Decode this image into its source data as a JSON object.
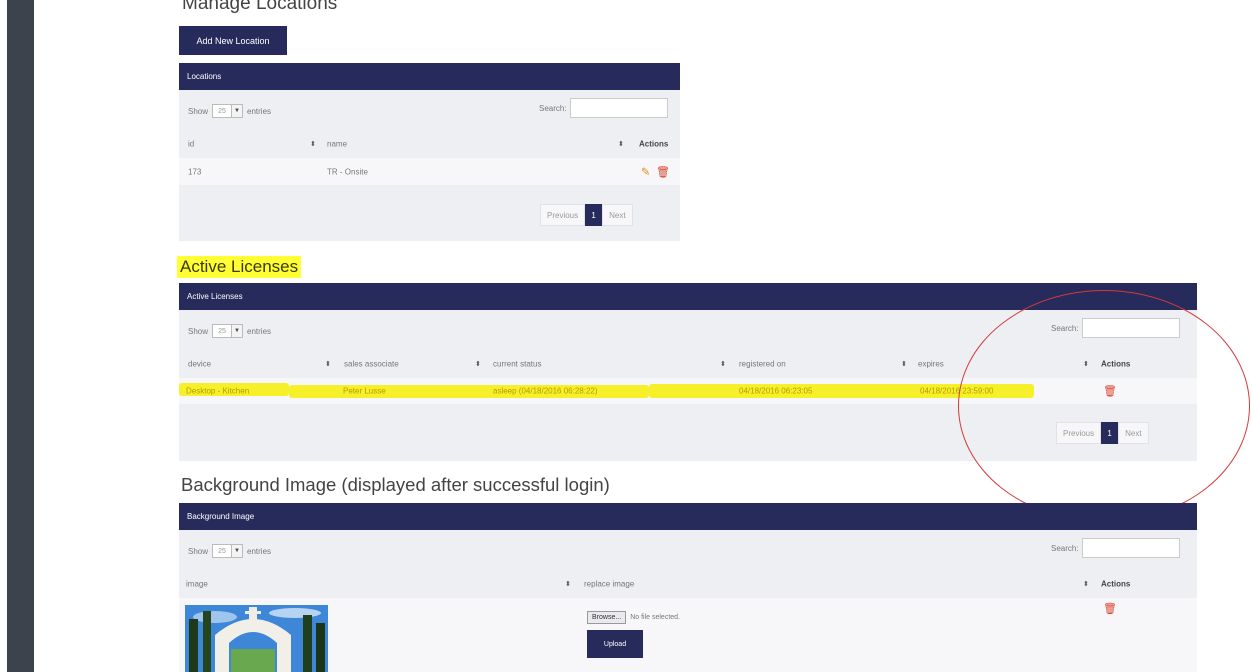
{
  "manage_locations": {
    "heading": "Manage Locations",
    "add_button": "Add New Location",
    "panel_title": "Locations",
    "show_label": "Show",
    "entries_value": "25",
    "entries_label": "entries",
    "search_label": "Search:",
    "columns": [
      "id",
      "name",
      "Actions"
    ],
    "rows": [
      {
        "id": "173",
        "name": "TR - Onsite"
      }
    ],
    "pager": {
      "prev": "Previous",
      "page": "1",
      "next": "Next"
    }
  },
  "active_licenses": {
    "heading": "Active Licenses",
    "panel_title": "Active Licenses",
    "show_label": "Show",
    "entries_value": "25",
    "entries_label": "entries",
    "search_label": "Search:",
    "columns": [
      "device",
      "sales associate",
      "current status",
      "registered on",
      "expires",
      "Actions"
    ],
    "rows": [
      {
        "device": "Desktop - Kitchen",
        "sales_associate": "Peter Lusse",
        "current_status": "asleep (04/18/2016 06:28:22)",
        "registered_on": "04/18/2016 06:23:05",
        "expires": "04/18/2016 23:59:00"
      }
    ],
    "pager": {
      "prev": "Previous",
      "page": "1",
      "next": "Next"
    }
  },
  "background_image": {
    "heading": "Background Image (displayed after successful login)",
    "panel_title": "Background Image",
    "show_label": "Show",
    "entries_value": "25",
    "entries_label": "entries",
    "search_label": "Search:",
    "columns": [
      "image",
      "replace image",
      "Actions"
    ],
    "browse_label": "Browse...",
    "no_file": "No file selected.",
    "upload_label": "Upload"
  },
  "icons": [
    "pencil-icon",
    "trash-icon",
    "sort-icon",
    "chevron-down-icon"
  ],
  "colors": {
    "header_navy": "#272b5b",
    "panel_bg": "#eeeff2",
    "sidebar": "#3d434c",
    "highlight": "#ffff33",
    "annotation_red": "#d23a3a",
    "delete_red": "#d9422b",
    "edit_orange": "#e08b19"
  }
}
